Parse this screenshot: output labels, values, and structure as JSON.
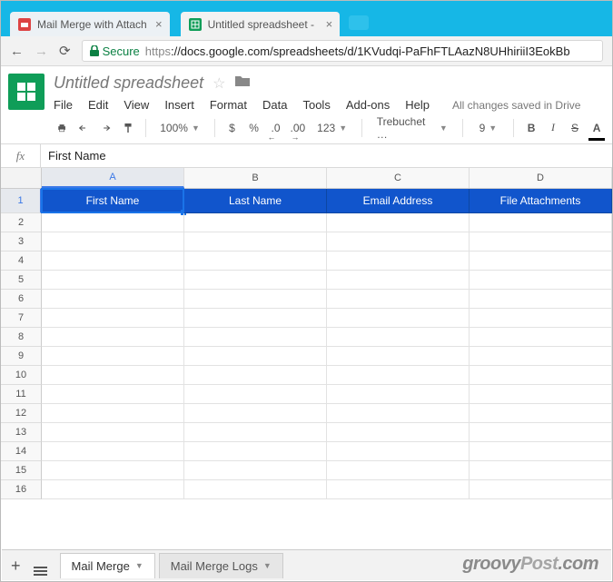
{
  "browser": {
    "tabs": [
      {
        "label": "Mail Merge with Attachm",
        "active": false
      },
      {
        "label": "Untitled spreadsheet - Go",
        "active": true
      }
    ],
    "secure_label": "Secure",
    "url_scheme": "https",
    "url_rest": "://docs.google.com/spreadsheets/d/1KVudqi-PaFhFTLAazN8UHhiriiI3EokBb"
  },
  "doc": {
    "title": "Untitled spreadsheet",
    "menus": [
      "File",
      "Edit",
      "View",
      "Insert",
      "Format",
      "Data",
      "Tools",
      "Add-ons",
      "Help"
    ],
    "saved": "All changes saved in Drive"
  },
  "toolbar": {
    "zoom": "100%",
    "currency": "$",
    "percent": "%",
    "dec_dec": ".0",
    "dec_inc": ".00",
    "more_formats": "123",
    "font": "Trebuchet …",
    "font_size": "9",
    "bold": "B",
    "italic": "I",
    "strike": "S",
    "textcolor": "A"
  },
  "formula_bar": {
    "fx": "fx",
    "value": "First Name"
  },
  "grid": {
    "columns": [
      "A",
      "B",
      "C",
      "D"
    ],
    "headers": [
      "First Name",
      "Last Name",
      "Email Address",
      "File Attachments"
    ],
    "blank_rows": 15,
    "first_blank_row": 2,
    "active_col": 0,
    "active_row": 1
  },
  "sheet_tabs": [
    {
      "label": "Mail Merge",
      "active": true
    },
    {
      "label": "Mail Merge Logs",
      "active": false
    }
  ],
  "watermark": "groovyPost.com"
}
